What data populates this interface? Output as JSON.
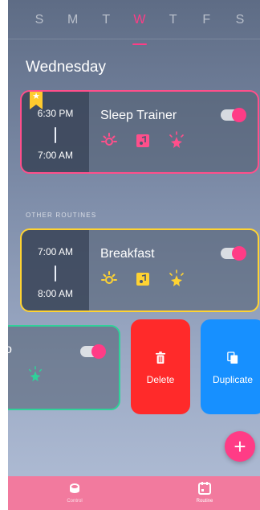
{
  "days": [
    "S",
    "M",
    "T",
    "W",
    "T",
    "F",
    "S"
  ],
  "selected_day_index": 3,
  "day_title": "Wednesday",
  "section_label": "OTHER ROUTINES",
  "routines": [
    {
      "name": "Sleep Trainer",
      "start": "6:30 PM",
      "end": "7:00 AM",
      "accent": "#ff4f8b",
      "enabled": true,
      "favorite": true,
      "icons": [
        "light-icon",
        "sound-icon",
        "sparkle-icon"
      ]
    },
    {
      "name": "Breakfast",
      "start": "7:00 AM",
      "end": "8:00 AM",
      "accent": "#ffd332",
      "enabled": true,
      "favorite": false,
      "icons": [
        "light-icon",
        "sound-icon",
        "sparkle-icon"
      ]
    },
    {
      "name_fragment": "o",
      "accent": "#2fd199",
      "enabled": true
    }
  ],
  "swipe_actions": {
    "delete_label": "Delete",
    "duplicate_label": "Duplicate",
    "delete_color": "#ff2a2a",
    "duplicate_color": "#1790ff"
  },
  "fab_symbol": "+",
  "bottom_nav": {
    "items": [
      {
        "label": "Control",
        "icon": "control-icon",
        "active": false
      },
      {
        "label": "Routine",
        "icon": "calendar-icon",
        "active": true
      }
    ]
  },
  "colors": {
    "accent_pink": "#ff3c86",
    "nav_background": "#f27a9e"
  }
}
